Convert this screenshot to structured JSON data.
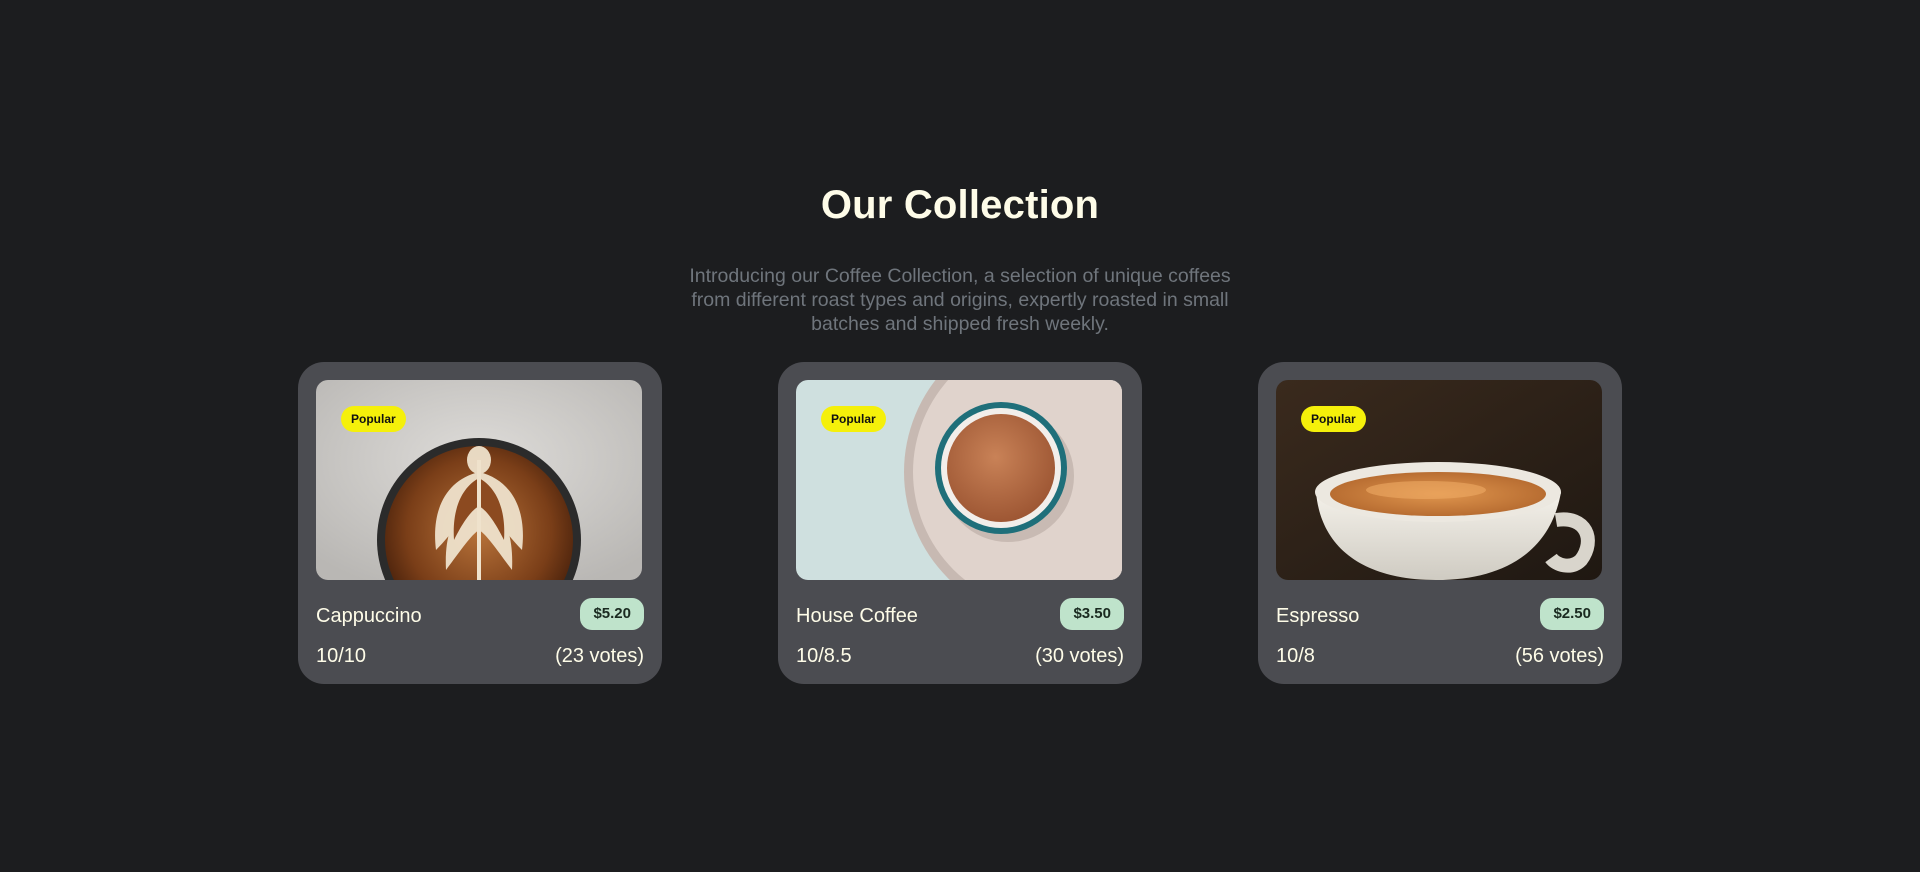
{
  "section": {
    "title": "Our Collection",
    "description": "Introducing our Coffee Collection, a selection of unique coffees from different roast types and origins, expertly roasted in small batches and shipped fresh weekly."
  },
  "products": [
    {
      "name": "Cappuccino",
      "price": "$5.20",
      "badge": "Popular",
      "rating": "10/10",
      "votes": "(23 votes)",
      "image": "cappuccino-latte-art-photo"
    },
    {
      "name": "House Coffee",
      "price": "$3.50",
      "badge": "Popular",
      "rating": "10/8.5",
      "votes": "(30 votes)",
      "image": "house-coffee-cup-photo"
    },
    {
      "name": "Espresso",
      "price": "$2.50",
      "badge": "Popular",
      "rating": "10/8",
      "votes": "(56 votes)",
      "image": "espresso-cup-photo"
    }
  ],
  "colors": {
    "background": "#1c1d1f",
    "card": "#4b4c51",
    "popular_badge": "#f5f00a",
    "price_badge": "#bfe3cb",
    "text_primary": "#fefce8",
    "text_muted": "#6f757c"
  }
}
